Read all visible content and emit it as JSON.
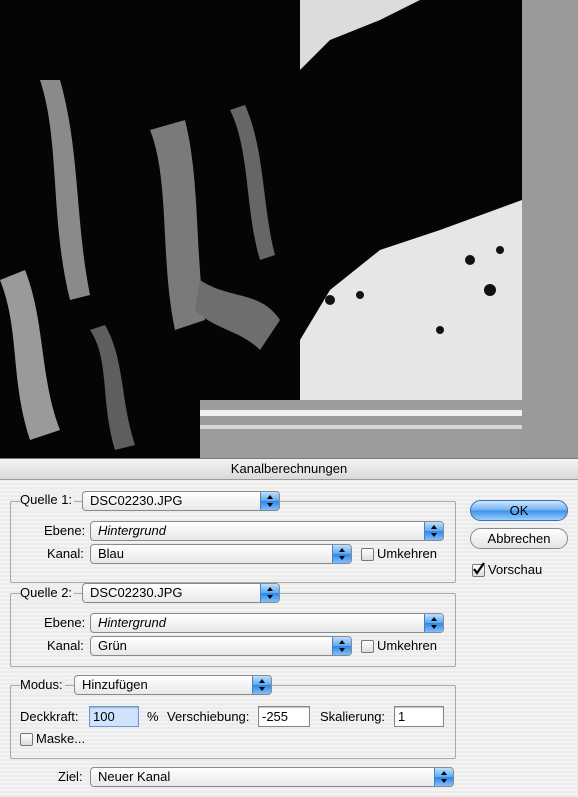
{
  "dialog": {
    "title": "Kanalberechnungen"
  },
  "source1": {
    "label": "Quelle 1:",
    "file": "DSC02230.JPG",
    "layer_label": "Ebene:",
    "layer": "Hintergrund",
    "channel_label": "Kanal:",
    "channel": "Blau",
    "invert_label": "Umkehren",
    "invert_checked": false
  },
  "source2": {
    "label": "Quelle 2:",
    "file": "DSC02230.JPG",
    "layer_label": "Ebene:",
    "layer": "Hintergrund",
    "channel_label": "Kanal:",
    "channel": "Grün",
    "invert_label": "Umkehren",
    "invert_checked": false
  },
  "blending": {
    "mode_label": "Modus:",
    "mode": "Hinzufügen",
    "opacity_label": "Deckkraft:",
    "opacity": "100",
    "percent": "%",
    "offset_label": "Verschiebung:",
    "offset": "-255",
    "scale_label": "Skalierung:",
    "scale": "1",
    "mask_label": "Maske...",
    "mask_checked": false
  },
  "result": {
    "label": "Ziel:",
    "value": "Neuer Kanal"
  },
  "buttons": {
    "ok": "OK",
    "cancel": "Abbrechen"
  },
  "preview": {
    "label": "Vorschau",
    "checked": true
  },
  "colors": {
    "accent": "#3d8fe8",
    "dialog_bg": "#ececec"
  }
}
